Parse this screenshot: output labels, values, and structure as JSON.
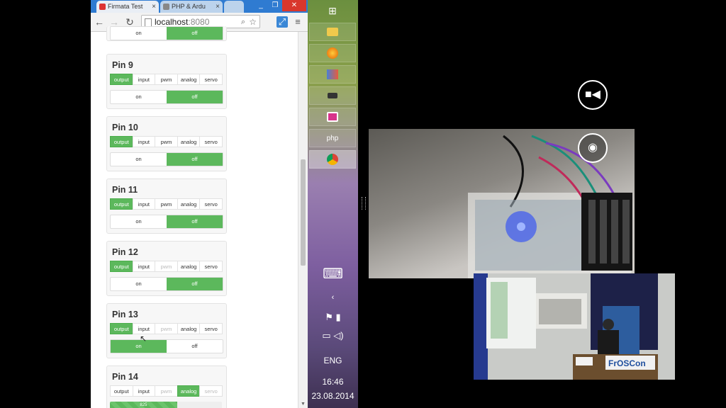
{
  "browser": {
    "tabs": [
      {
        "title": "Firmata Test"
      },
      {
        "title": "PHP & Ardu"
      }
    ],
    "address": {
      "host": "localhost",
      "port": ":8080"
    },
    "pins": [
      {
        "label": "Pin 9",
        "modes": [
          "output",
          "input",
          "pwm",
          "analog",
          "servo"
        ],
        "active_mode": "output",
        "toggle": [
          "on",
          "off"
        ],
        "state": "off"
      },
      {
        "label": "Pin 10",
        "modes": [
          "output",
          "input",
          "pwm",
          "analog",
          "servo"
        ],
        "active_mode": "output",
        "toggle": [
          "on",
          "off"
        ],
        "state": "off"
      },
      {
        "label": "Pin 11",
        "modes": [
          "output",
          "input",
          "pwm",
          "analog",
          "servo"
        ],
        "active_mode": "output",
        "toggle": [
          "on",
          "off"
        ],
        "state": "off"
      },
      {
        "label": "Pin 12",
        "modes": [
          "output",
          "input",
          "pwm",
          "analog",
          "servo"
        ],
        "active_mode": "output",
        "toggle": [
          "on",
          "off"
        ],
        "state": "off"
      },
      {
        "label": "Pin 13",
        "modes": [
          "output",
          "input",
          "pwm",
          "analog",
          "servo"
        ],
        "active_mode": "output",
        "toggle": [
          "on",
          "off"
        ],
        "state": "on"
      },
      {
        "label": "Pin 14",
        "modes": [
          "output",
          "input",
          "pwm",
          "analog",
          "servo"
        ],
        "active_mode": "analog",
        "progress_value": "825",
        "progress_fraction": 0.6
      }
    ],
    "top_partial_toggle": [
      "on",
      "off"
    ]
  },
  "taskbar": {
    "apps": [
      "windows",
      "explorer",
      "firefox",
      "paint",
      "drive",
      "camera",
      "php",
      "chrome"
    ],
    "php_label": "php",
    "language": "ENG",
    "time": "16:46",
    "date": "23.08.2014"
  },
  "colors": {
    "accent_green": "#5cb85c",
    "titlebar_blue": "#2f7bd1"
  }
}
